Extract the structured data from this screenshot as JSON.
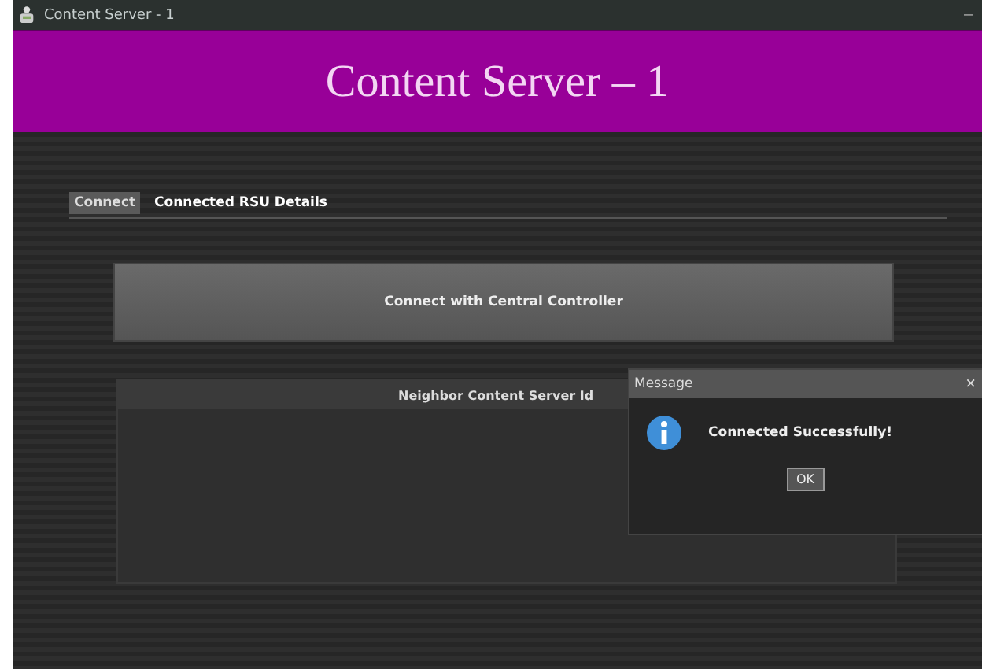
{
  "window": {
    "title": "Content Server - 1",
    "minimize": "–"
  },
  "banner": {
    "title": "Content Server – 1"
  },
  "tabs": [
    {
      "label": "Connect",
      "selected": true
    },
    {
      "label": "Connected RSU Details",
      "selected": false
    }
  ],
  "connect_button": "Connect with Central Controller",
  "table": {
    "columns": [
      "Neighbor Content Server Id"
    ]
  },
  "dialog": {
    "title": "Message",
    "close": "×",
    "message": "Connected Successfully!",
    "button": "OK"
  }
}
